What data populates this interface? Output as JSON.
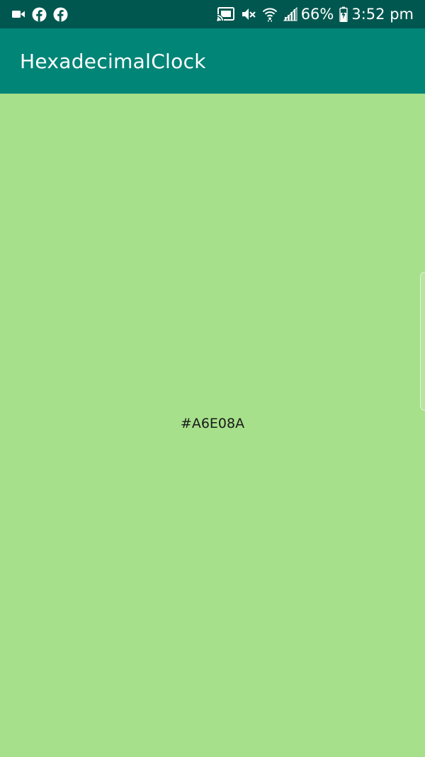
{
  "status_bar": {
    "left_icons": [
      "video-camera-icon",
      "facebook-icon",
      "facebook-icon"
    ],
    "right_icons": [
      "cast-icon",
      "mute-icon",
      "wifi-icon",
      "signal-icon",
      "battery-charging-icon"
    ],
    "battery_percent": "66%",
    "time": "3:52 pm",
    "background_color": "#00574f"
  },
  "app_bar": {
    "title": "HexadecimalClock",
    "background_color": "#008577"
  },
  "main": {
    "hex_value": "#A6E08A",
    "background_color": "#A6E08A"
  }
}
